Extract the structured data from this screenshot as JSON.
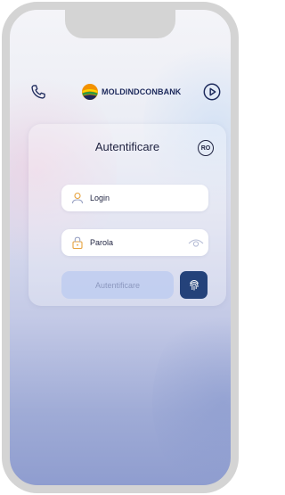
{
  "header": {
    "bank_name": "MOLDINDCONBANK"
  },
  "login_card": {
    "title": "Autentificare",
    "language": "RO",
    "login_placeholder": "Login",
    "password_placeholder": "Parola",
    "submit_label": "Autentificare"
  },
  "colors": {
    "brand_navy": "#1d2a5c",
    "button_dark": "#24427a",
    "button_disabled": "#bccdf0",
    "logo_orange": "#f39200",
    "logo_green": "#2e9b3e",
    "logo_yellow": "#ffd400"
  },
  "icons": {
    "phone": "phone-icon",
    "play": "play-icon",
    "user": "user-icon",
    "lock": "lock-icon",
    "eye": "eye-icon",
    "fingerprint": "fingerprint-icon"
  }
}
